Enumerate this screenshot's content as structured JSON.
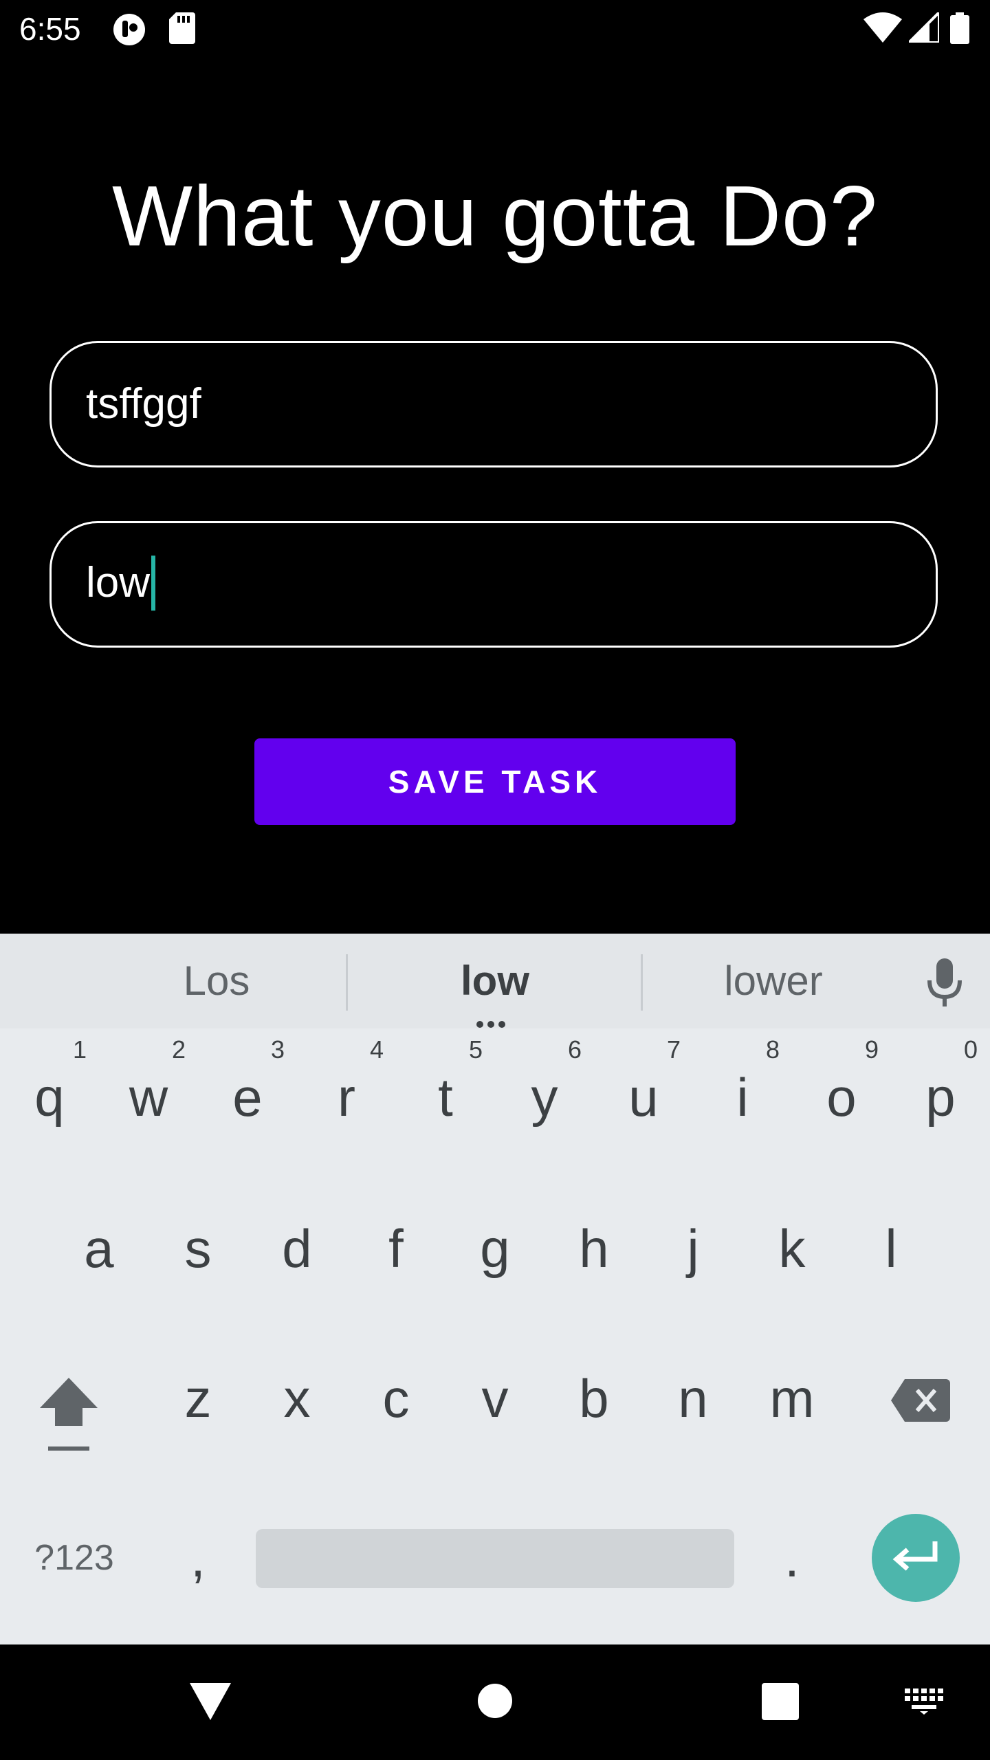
{
  "status_bar": {
    "time": "6:55",
    "icons": [
      "notification-app-icon",
      "sd-card-icon",
      "wifi-icon",
      "signal-icon",
      "battery-icon"
    ]
  },
  "app": {
    "title": "What you gotta Do?",
    "task_field": {
      "value": "tsffggf"
    },
    "priority_field": {
      "value": "low"
    },
    "save_button_label": "SAVE TASK",
    "accent_color": "#6200ee"
  },
  "keyboard": {
    "suggestions": [
      "Los",
      "low",
      "lower"
    ],
    "row1": [
      {
        "key": "q",
        "hint": "1"
      },
      {
        "key": "w",
        "hint": "2"
      },
      {
        "key": "e",
        "hint": "3"
      },
      {
        "key": "r",
        "hint": "4"
      },
      {
        "key": "t",
        "hint": "5"
      },
      {
        "key": "y",
        "hint": "6"
      },
      {
        "key": "u",
        "hint": "7"
      },
      {
        "key": "i",
        "hint": "8"
      },
      {
        "key": "o",
        "hint": "9"
      },
      {
        "key": "p",
        "hint": "0"
      }
    ],
    "row2": [
      "a",
      "s",
      "d",
      "f",
      "g",
      "h",
      "j",
      "k",
      "l"
    ],
    "row3": [
      "z",
      "x",
      "c",
      "v",
      "b",
      "n",
      "m"
    ],
    "symbols_key": "?123",
    "comma_key": ",",
    "period_key": ".",
    "enter_color": "#4db6ac"
  },
  "nav_bar": {
    "icons": [
      "back-icon",
      "home-icon",
      "recents-icon",
      "keyboard-switch-icon"
    ]
  }
}
